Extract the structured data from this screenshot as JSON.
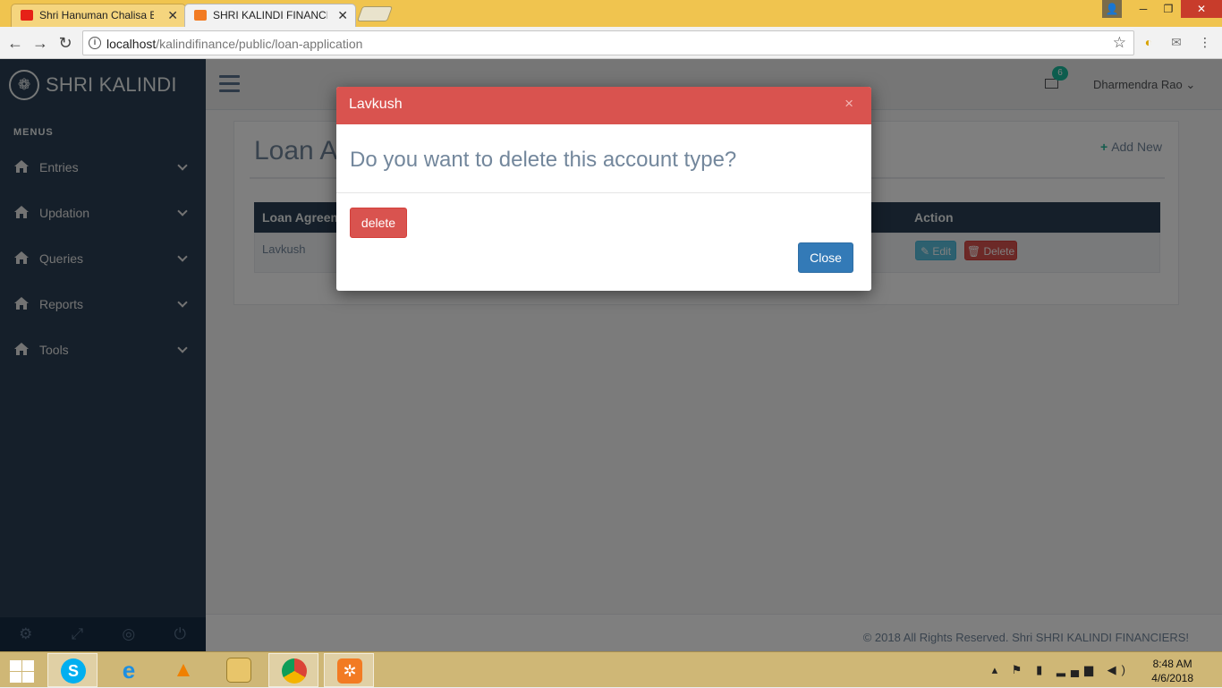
{
  "browser": {
    "tabs": [
      {
        "title": "Shri Hanuman Chalisa Bh",
        "favicon_color": "#e62117",
        "active": false
      },
      {
        "title": "SHRI KALINDI FINANCIEF",
        "favicon_color": "#f27b23",
        "active": true
      }
    ],
    "url_host": "localhost",
    "url_path": "/kalindifinance/public/loan-application"
  },
  "sidebar": {
    "brand": "SHRI KALINDI",
    "menu_header": "MENUS",
    "items": [
      {
        "label": "Entries"
      },
      {
        "label": "Updation"
      },
      {
        "label": "Queries"
      },
      {
        "label": "Reports"
      },
      {
        "label": "Tools"
      }
    ]
  },
  "topnav": {
    "mail_count": "6",
    "user_name": "Dharmendra Rao"
  },
  "panel": {
    "title": "Loan A",
    "add_new": "Add New",
    "table": {
      "headers": [
        "Loan Agreem",
        "Action"
      ],
      "rows": [
        {
          "name": "Lavkush",
          "edit": "Edit",
          "delete": "Delete"
        }
      ]
    }
  },
  "footer": {
    "text": "© 2018 All Rights Reserved. Shri SHRI KALINDI FINANCIERS!"
  },
  "modal": {
    "title": "Lavkush",
    "close_x": "×",
    "question": "Do you want to delete this account type?",
    "delete_label": "delete",
    "close_label": "Close"
  },
  "taskbar": {
    "time": "8:48 AM",
    "date": "4/6/2018"
  },
  "colors": {
    "sidebar": "#2a3f54",
    "danger": "#d9534f",
    "primary": "#337ab7",
    "info": "#5bc0de",
    "success": "#1abb9c"
  }
}
